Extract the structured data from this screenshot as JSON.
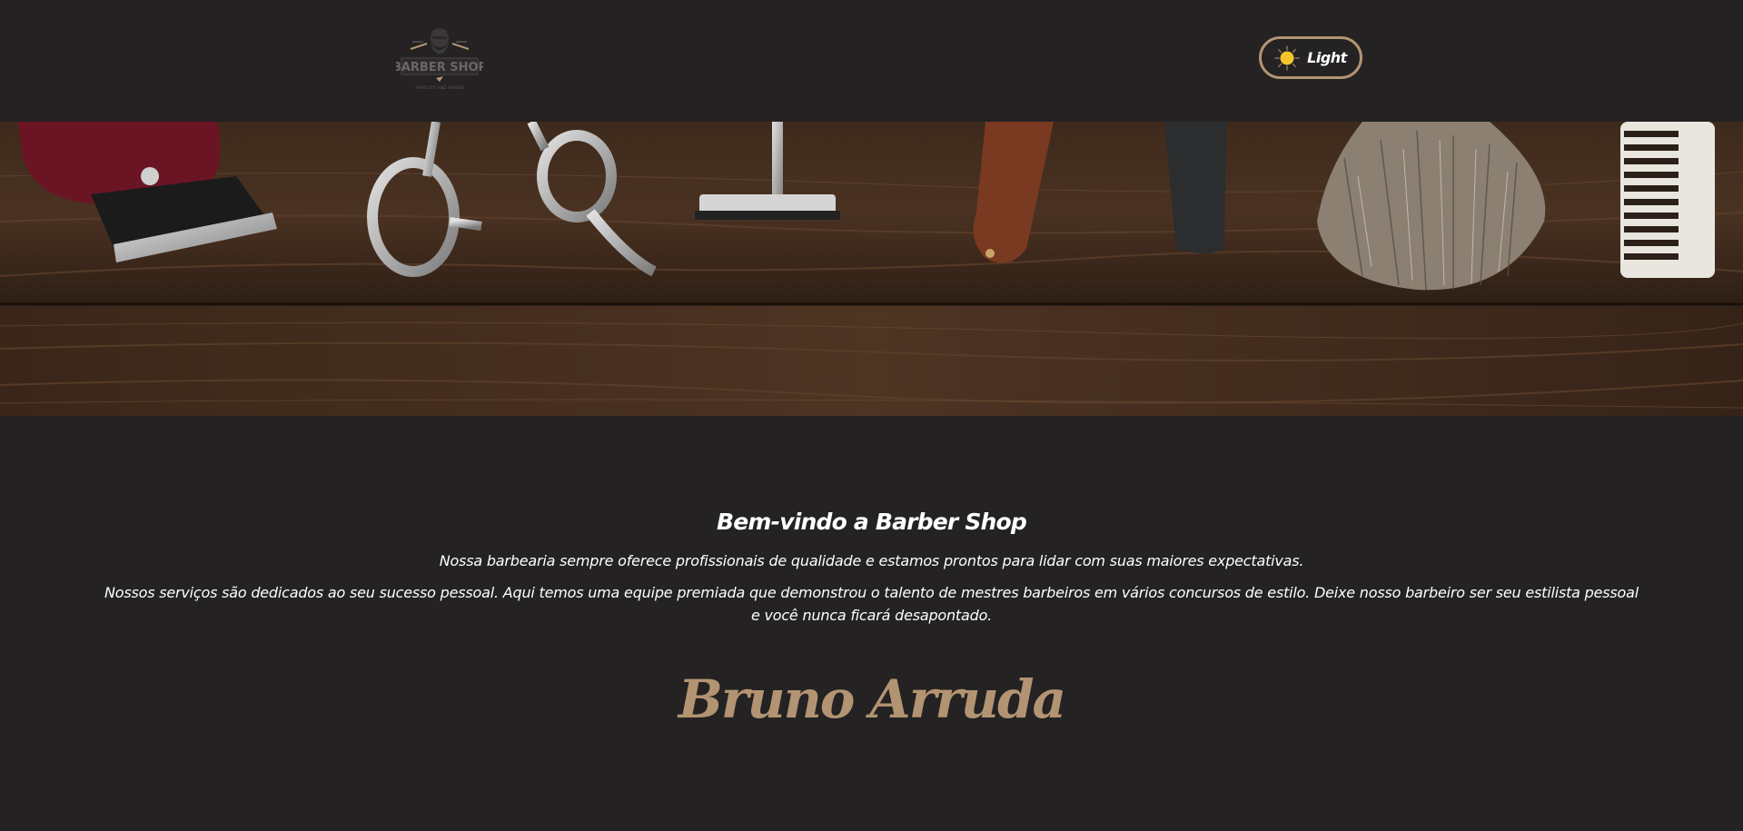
{
  "header": {
    "logo_text": "BARBER SHOP",
    "logo_tagline": "HAIRCUTS AND SHAVES",
    "theme_toggle": {
      "label": "Light",
      "icon": "sun-icon"
    }
  },
  "banner": {
    "alt": "barber tools on wooden table",
    "tools": [
      "clipper",
      "scissors",
      "safety-razor",
      "straight-razor",
      "shaving-brush",
      "comb"
    ]
  },
  "content": {
    "title": "Bem-vindo a Barber Shop",
    "paragraph_1": "Nossa barbearia sempre oferece profissionais de qualidade e estamos prontos para lidar com suas maiores expectativas.",
    "paragraph_2": "Nossos serviços são dedicados ao seu sucesso pessoal. Aqui temos uma equipe premiada que demonstrou o talento de mestres barbeiros em vários concursos de estilo. Deixe nosso barbeiro ser seu estilista pessoal e você nunca ficará desapontado.",
    "signature": "Bruno Arruda"
  },
  "colors": {
    "background": "#242223",
    "accent": "#b39472",
    "text": "#ffffff",
    "sun": "#f7c52b"
  }
}
